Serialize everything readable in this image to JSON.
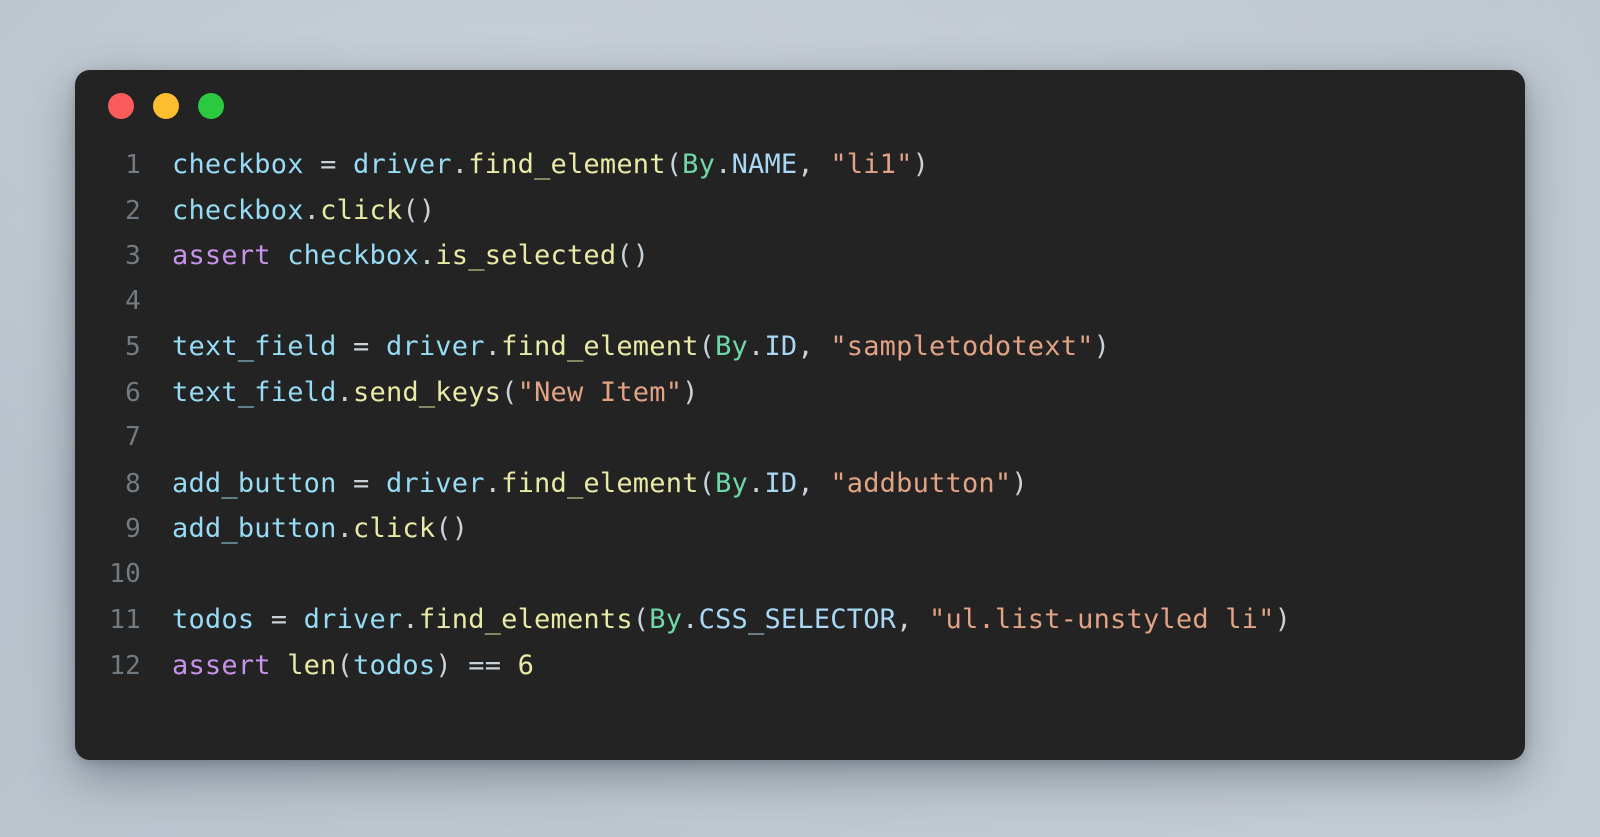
{
  "window": {
    "background_gradient_from": "#b4bfc9",
    "background_gradient_to": "#c4ccd3",
    "panel_background": "#232323",
    "traffic_lights": [
      {
        "name": "close",
        "color": "#fa5c5c"
      },
      {
        "name": "minimize",
        "color": "#fcbd2e"
      },
      {
        "name": "maximize",
        "color": "#2ac940"
      }
    ]
  },
  "editor": {
    "language": "python",
    "colors": {
      "variable": "#96dcf5",
      "function": "#e8eaa6",
      "keyword": "#c792ea",
      "class": "#6fd8a8",
      "constant": "#a8d8f5",
      "string": "#e2a284",
      "number": "#e8eaa6",
      "operator": "#c9d1d9",
      "line_number": "#737b82"
    },
    "lines": [
      {
        "number": "1",
        "text": "checkbox = driver.find_element(By.NAME, \"li1\")"
      },
      {
        "number": "2",
        "text": "checkbox.click()"
      },
      {
        "number": "3",
        "text": "assert checkbox.is_selected()"
      },
      {
        "number": "4",
        "text": ""
      },
      {
        "number": "5",
        "text": "text_field = driver.find_element(By.ID, \"sampletodotext\")"
      },
      {
        "number": "6",
        "text": "text_field.send_keys(\"New Item\")"
      },
      {
        "number": "7",
        "text": ""
      },
      {
        "number": "8",
        "text": "add_button = driver.find_element(By.ID, \"addbutton\")"
      },
      {
        "number": "9",
        "text": "add_button.click()"
      },
      {
        "number": "10",
        "text": ""
      },
      {
        "number": "11",
        "text": "todos = driver.find_elements(By.CSS_SELECTOR, \"ul.list-unstyled li\")"
      },
      {
        "number": "12",
        "text": "assert len(todos) == 6"
      }
    ],
    "tokens": [
      [
        {
          "t": "checkbox",
          "c": "t-var"
        },
        {
          "t": " = ",
          "c": "t-op"
        },
        {
          "t": "driver",
          "c": "t-var"
        },
        {
          "t": ".",
          "c": "t-op"
        },
        {
          "t": "find_element",
          "c": "t-fn"
        },
        {
          "t": "(",
          "c": "t-op"
        },
        {
          "t": "By",
          "c": "t-cls"
        },
        {
          "t": ".",
          "c": "t-op"
        },
        {
          "t": "NAME",
          "c": "t-const"
        },
        {
          "t": ", ",
          "c": "t-op"
        },
        {
          "t": "\"li1\"",
          "c": "t-str"
        },
        {
          "t": ")",
          "c": "t-op"
        }
      ],
      [
        {
          "t": "checkbox",
          "c": "t-var"
        },
        {
          "t": ".",
          "c": "t-op"
        },
        {
          "t": "click",
          "c": "t-fn"
        },
        {
          "t": "()",
          "c": "t-op"
        }
      ],
      [
        {
          "t": "assert",
          "c": "t-kw"
        },
        {
          "t": " ",
          "c": "t-op"
        },
        {
          "t": "checkbox",
          "c": "t-var"
        },
        {
          "t": ".",
          "c": "t-op"
        },
        {
          "t": "is_selected",
          "c": "t-fn"
        },
        {
          "t": "()",
          "c": "t-op"
        }
      ],
      [],
      [
        {
          "t": "text_field",
          "c": "t-var"
        },
        {
          "t": " = ",
          "c": "t-op"
        },
        {
          "t": "driver",
          "c": "t-var"
        },
        {
          "t": ".",
          "c": "t-op"
        },
        {
          "t": "find_element",
          "c": "t-fn"
        },
        {
          "t": "(",
          "c": "t-op"
        },
        {
          "t": "By",
          "c": "t-cls"
        },
        {
          "t": ".",
          "c": "t-op"
        },
        {
          "t": "ID",
          "c": "t-const"
        },
        {
          "t": ", ",
          "c": "t-op"
        },
        {
          "t": "\"sampletodotext\"",
          "c": "t-str"
        },
        {
          "t": ")",
          "c": "t-op"
        }
      ],
      [
        {
          "t": "text_field",
          "c": "t-var"
        },
        {
          "t": ".",
          "c": "t-op"
        },
        {
          "t": "send_keys",
          "c": "t-fn"
        },
        {
          "t": "(",
          "c": "t-op"
        },
        {
          "t": "\"New Item\"",
          "c": "t-str"
        },
        {
          "t": ")",
          "c": "t-op"
        }
      ],
      [],
      [
        {
          "t": "add_button",
          "c": "t-var"
        },
        {
          "t": " = ",
          "c": "t-op"
        },
        {
          "t": "driver",
          "c": "t-var"
        },
        {
          "t": ".",
          "c": "t-op"
        },
        {
          "t": "find_element",
          "c": "t-fn"
        },
        {
          "t": "(",
          "c": "t-op"
        },
        {
          "t": "By",
          "c": "t-cls"
        },
        {
          "t": ".",
          "c": "t-op"
        },
        {
          "t": "ID",
          "c": "t-const"
        },
        {
          "t": ", ",
          "c": "t-op"
        },
        {
          "t": "\"addbutton\"",
          "c": "t-str"
        },
        {
          "t": ")",
          "c": "t-op"
        }
      ],
      [
        {
          "t": "add_button",
          "c": "t-var"
        },
        {
          "t": ".",
          "c": "t-op"
        },
        {
          "t": "click",
          "c": "t-fn"
        },
        {
          "t": "()",
          "c": "t-op"
        }
      ],
      [],
      [
        {
          "t": "todos",
          "c": "t-var"
        },
        {
          "t": " = ",
          "c": "t-op"
        },
        {
          "t": "driver",
          "c": "t-var"
        },
        {
          "t": ".",
          "c": "t-op"
        },
        {
          "t": "find_elements",
          "c": "t-fn"
        },
        {
          "t": "(",
          "c": "t-op"
        },
        {
          "t": "By",
          "c": "t-cls"
        },
        {
          "t": ".",
          "c": "t-op"
        },
        {
          "t": "CSS_SELECTOR",
          "c": "t-const"
        },
        {
          "t": ", ",
          "c": "t-op"
        },
        {
          "t": "\"ul.list-unstyled li\"",
          "c": "t-str"
        },
        {
          "t": ")",
          "c": "t-op"
        }
      ],
      [
        {
          "t": "assert",
          "c": "t-kw"
        },
        {
          "t": " ",
          "c": "t-op"
        },
        {
          "t": "len",
          "c": "t-fn"
        },
        {
          "t": "(",
          "c": "t-op"
        },
        {
          "t": "todos",
          "c": "t-var"
        },
        {
          "t": ") == ",
          "c": "t-op"
        },
        {
          "t": "6",
          "c": "t-num"
        }
      ]
    ]
  }
}
